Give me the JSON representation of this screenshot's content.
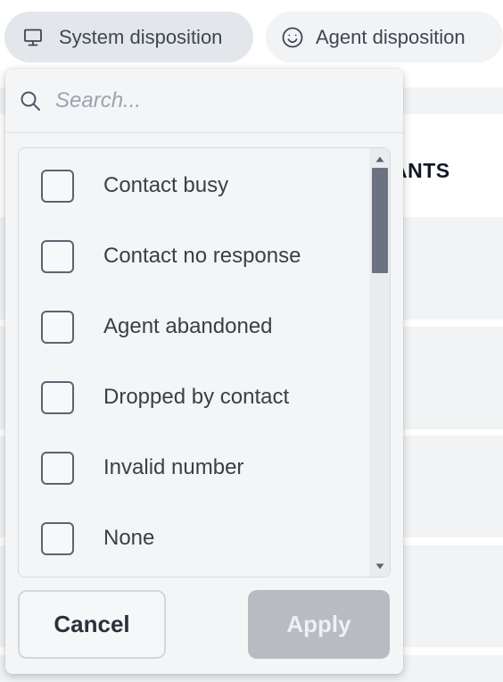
{
  "filters": {
    "system_disposition": {
      "label": "System disposition",
      "icon": "monitor-icon"
    },
    "agent_disposition": {
      "label": "Agent disposition",
      "icon": "smiley-face-icon"
    }
  },
  "background_table": {
    "header_fragment": "ANTS"
  },
  "dropdown": {
    "search": {
      "placeholder": "Search...",
      "value": ""
    },
    "options": [
      {
        "label": "Contact busy",
        "checked": false
      },
      {
        "label": "Contact no response",
        "checked": false
      },
      {
        "label": "Agent abandoned",
        "checked": false
      },
      {
        "label": "Dropped by contact",
        "checked": false
      },
      {
        "label": "Invalid number",
        "checked": false
      },
      {
        "label": "None",
        "checked": false
      }
    ],
    "scroll": {
      "position_fraction": 0.0,
      "visible_fraction": 0.27
    },
    "cancel_label": "Cancel",
    "apply_label": "Apply",
    "apply_enabled": false
  },
  "colors": {
    "chip_active_bg": "#e3e7ec",
    "chip_bg": "#f1f3f5",
    "panel_bg": "#f4f5f7",
    "apply_disabled_bg": "#b8bcc2",
    "scroll_thumb": "#6b7380"
  }
}
